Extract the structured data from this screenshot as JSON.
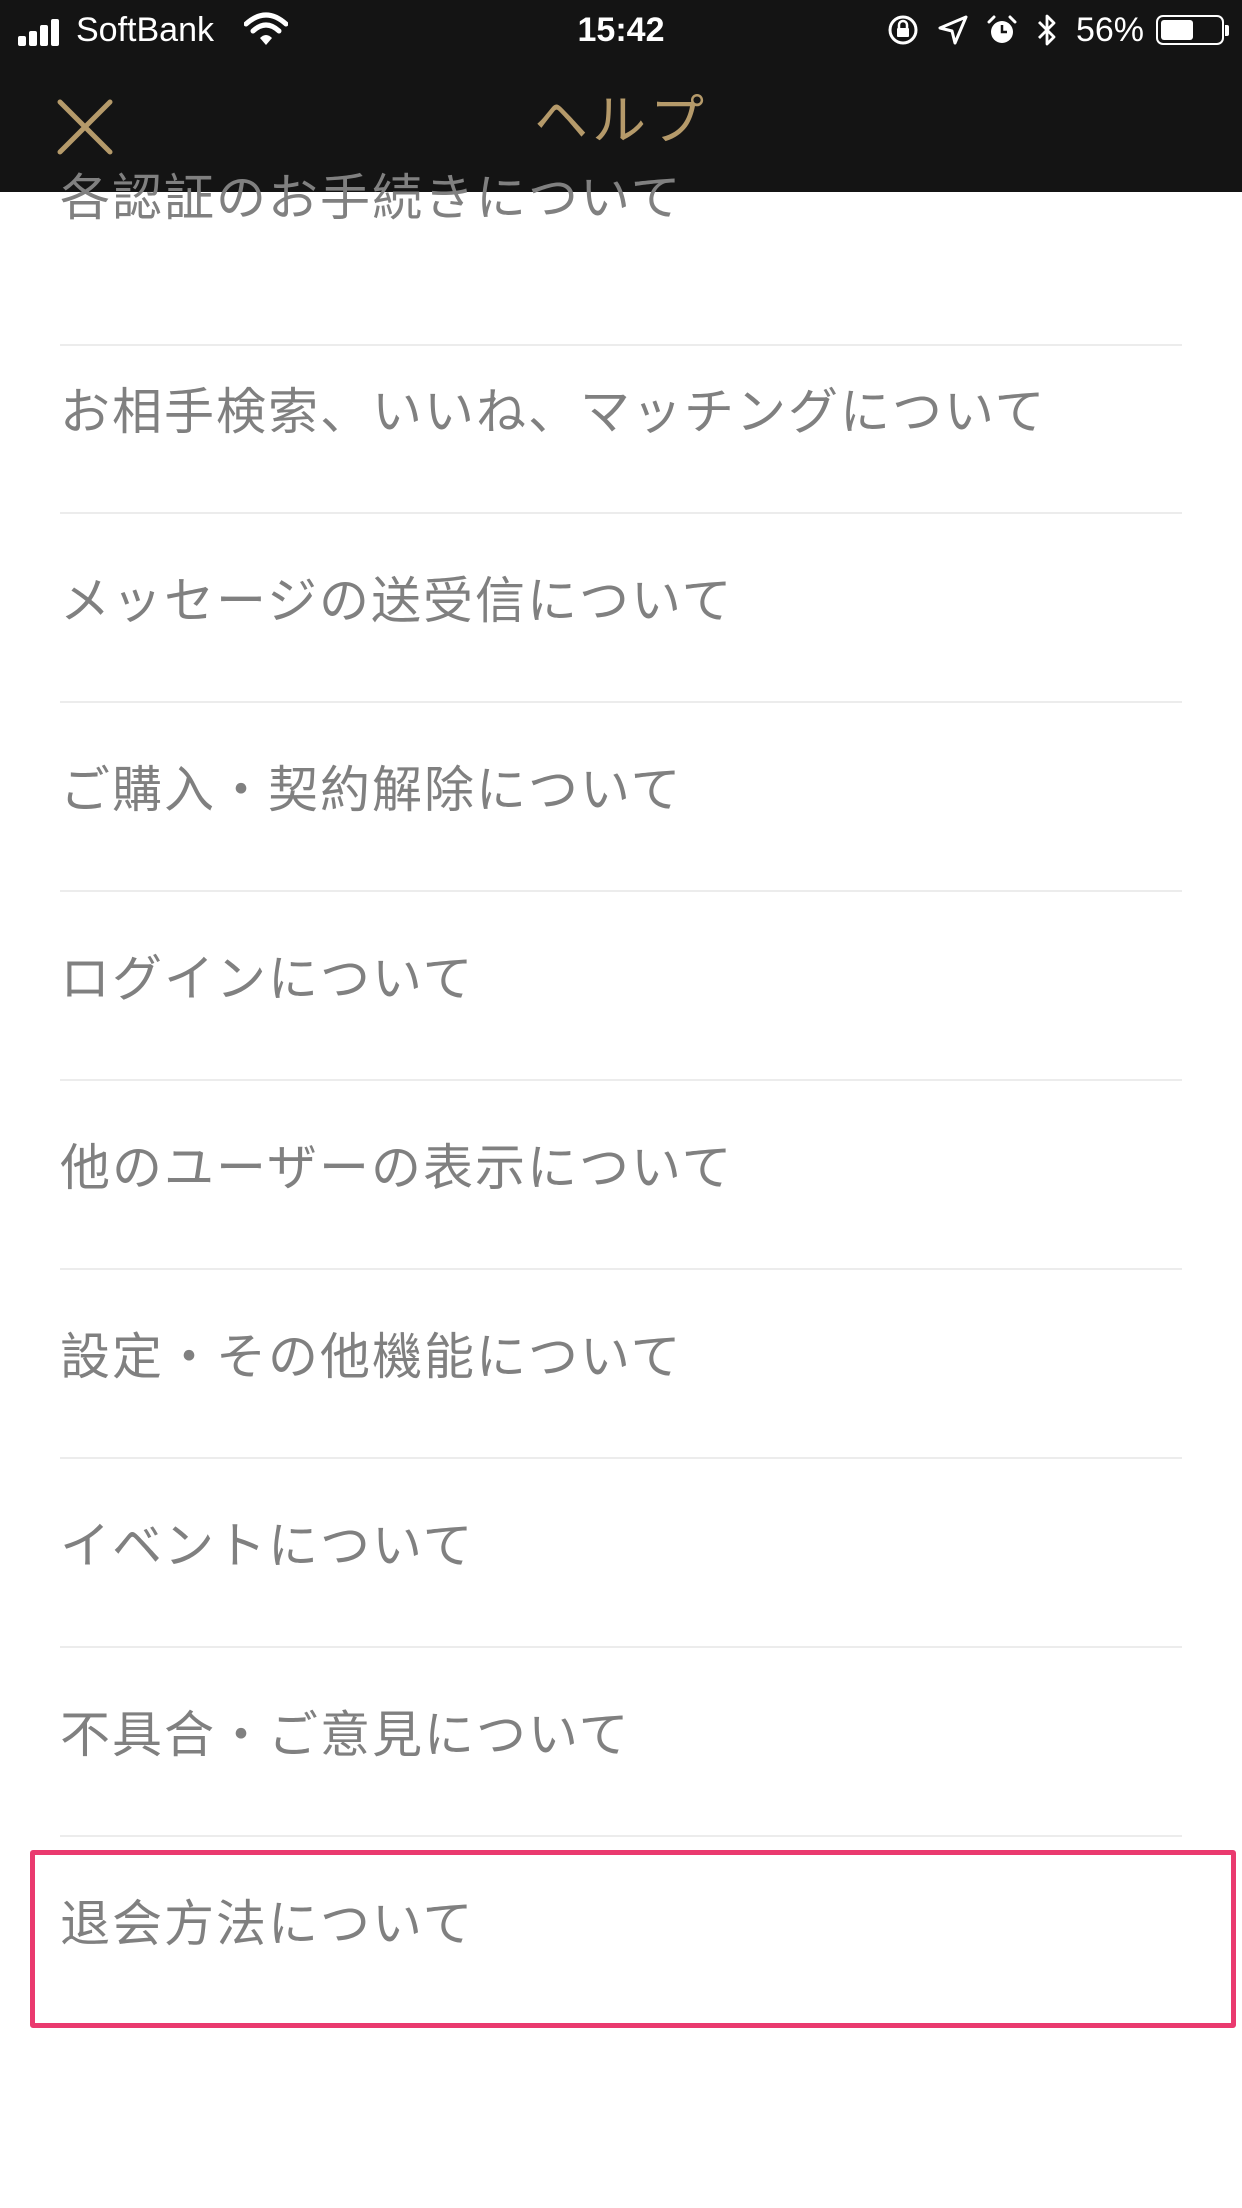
{
  "status_bar": {
    "carrier": "SoftBank",
    "time": "15:42",
    "battery_percent": "56%",
    "battery_level": 0.56,
    "icons": [
      "signal-icon",
      "wifi-icon",
      "rotation-lock-icon",
      "location-icon",
      "alarm-icon",
      "bluetooth-icon",
      "battery-icon"
    ]
  },
  "nav": {
    "title": "ヘルプ",
    "close_icon": "close-icon"
  },
  "colors": {
    "header_bg": "#141414",
    "title_gold": "#b59a6a",
    "item_text": "#808080",
    "divider": "#ececec",
    "highlight": "#ea3a6f"
  },
  "help_items": [
    {
      "label": "各認証のお手続きについて"
    },
    {
      "label": "お相手検索、いいね、マッチングについて"
    },
    {
      "label": "メッセージの送受信について"
    },
    {
      "label": "ご購入・契約解除について"
    },
    {
      "label": "ログインについて"
    },
    {
      "label": "他のユーザーの表示について"
    },
    {
      "label": "設定・その他機能について"
    },
    {
      "label": "イベントについて"
    },
    {
      "label": "不具合・ご意見について"
    },
    {
      "label": "退会方法について",
      "highlighted": true
    }
  ]
}
